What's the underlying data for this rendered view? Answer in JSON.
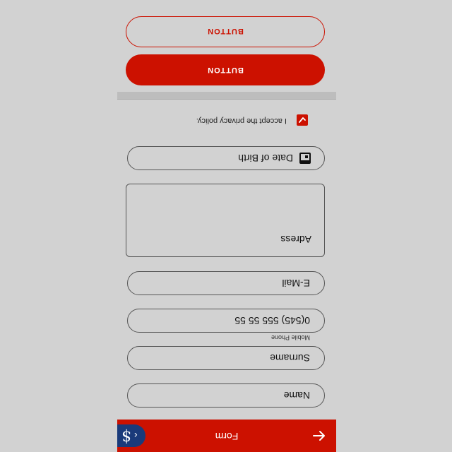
{
  "app_bar": {
    "title": "Form",
    "back_icon": "arrow-left-icon",
    "brand_icon": "dollar-logo-icon",
    "chevron": "‹",
    "logo_glyph": "$"
  },
  "form": {
    "name_label": "Name",
    "surname_label": "Surname",
    "mobile_floating_label": "Mobile Phone",
    "mobile_value": "0(545) 555 55 55",
    "email_label": "E-Mail",
    "address_label": "Adress",
    "dob_label": "Date of Birth",
    "dob_icon": "calendar-icon"
  },
  "consent": {
    "text": "I accept the privacy policy.",
    "checked": true
  },
  "buttons": {
    "primary_label": "BUTTON",
    "secondary_label": "BUTTON"
  },
  "colors": {
    "accent": "#cc1100",
    "brand_badge": "#1a3a7a",
    "background": "#d2d2d2"
  }
}
